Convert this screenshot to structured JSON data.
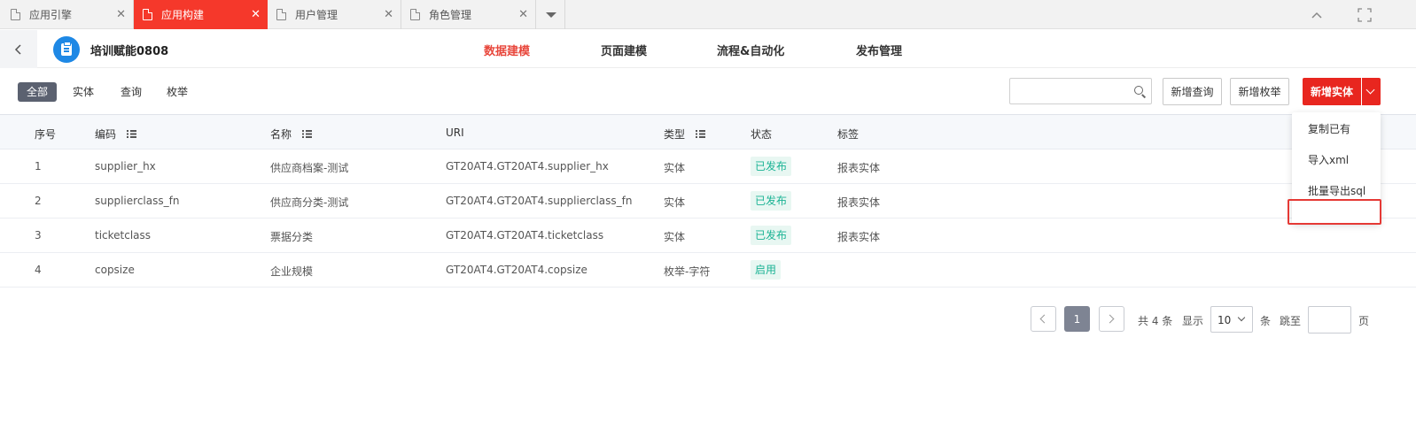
{
  "tabs": [
    {
      "label": "应用引擎",
      "active": false
    },
    {
      "label": "应用构建",
      "active": true
    },
    {
      "label": "用户管理",
      "active": false
    },
    {
      "label": "角色管理",
      "active": false
    }
  ],
  "header": {
    "app_title": "培训赋能0808",
    "nav": [
      "数据建模",
      "页面建模",
      "流程&自动化",
      "发布管理"
    ],
    "active_nav": "数据建模"
  },
  "toolbar": {
    "filters": [
      "全部",
      "实体",
      "查询",
      "枚举"
    ],
    "active_filter": "全部",
    "search_placeholder": "",
    "new_query": "新增查询",
    "new_enum": "新增枚举",
    "new_entity": "新增实体"
  },
  "dropdown": {
    "items": [
      "复制已有",
      "导入xml",
      "批量导出sql"
    ],
    "highlighted": "批量导出sql"
  },
  "table": {
    "columns": {
      "index": "序号",
      "code": "编码",
      "name": "名称",
      "uri": "URI",
      "type": "类型",
      "status": "状态",
      "tags": "标签"
    },
    "rows": [
      {
        "index": "1",
        "code": "supplier_hx",
        "name": "供应商档案-测试",
        "uri": "GT20AT4.GT20AT4.supplier_hx",
        "type": "实体",
        "status": "已发布",
        "tags": "报表实体"
      },
      {
        "index": "2",
        "code": "supplierclass_fn",
        "name": "供应商分类-测试",
        "uri": "GT20AT4.GT20AT4.supplierclass_fn",
        "type": "实体",
        "status": "已发布",
        "tags": "报表实体"
      },
      {
        "index": "3",
        "code": "ticketclass",
        "name": "票据分类",
        "uri": "GT20AT4.GT20AT4.ticketclass",
        "type": "实体",
        "status": "已发布",
        "tags": "报表实体"
      },
      {
        "index": "4",
        "code": "copsize",
        "name": "企业规模",
        "uri": "GT20AT4.GT20AT4.copsize",
        "type": "枚举-字符",
        "status": "启用",
        "tags": ""
      }
    ]
  },
  "pagination": {
    "current_page": "1",
    "total_text": "共 4 条",
    "show_label": "显示",
    "page_size": "10",
    "unit_label": "条",
    "jump_label": "跳至",
    "page_label": "页"
  },
  "colors": {
    "accent": "#e8261f",
    "active_tab": "#f5382b",
    "active_nav": "#e8473c",
    "status_text": "#1ab394",
    "status_bg": "#e8f7f2"
  }
}
